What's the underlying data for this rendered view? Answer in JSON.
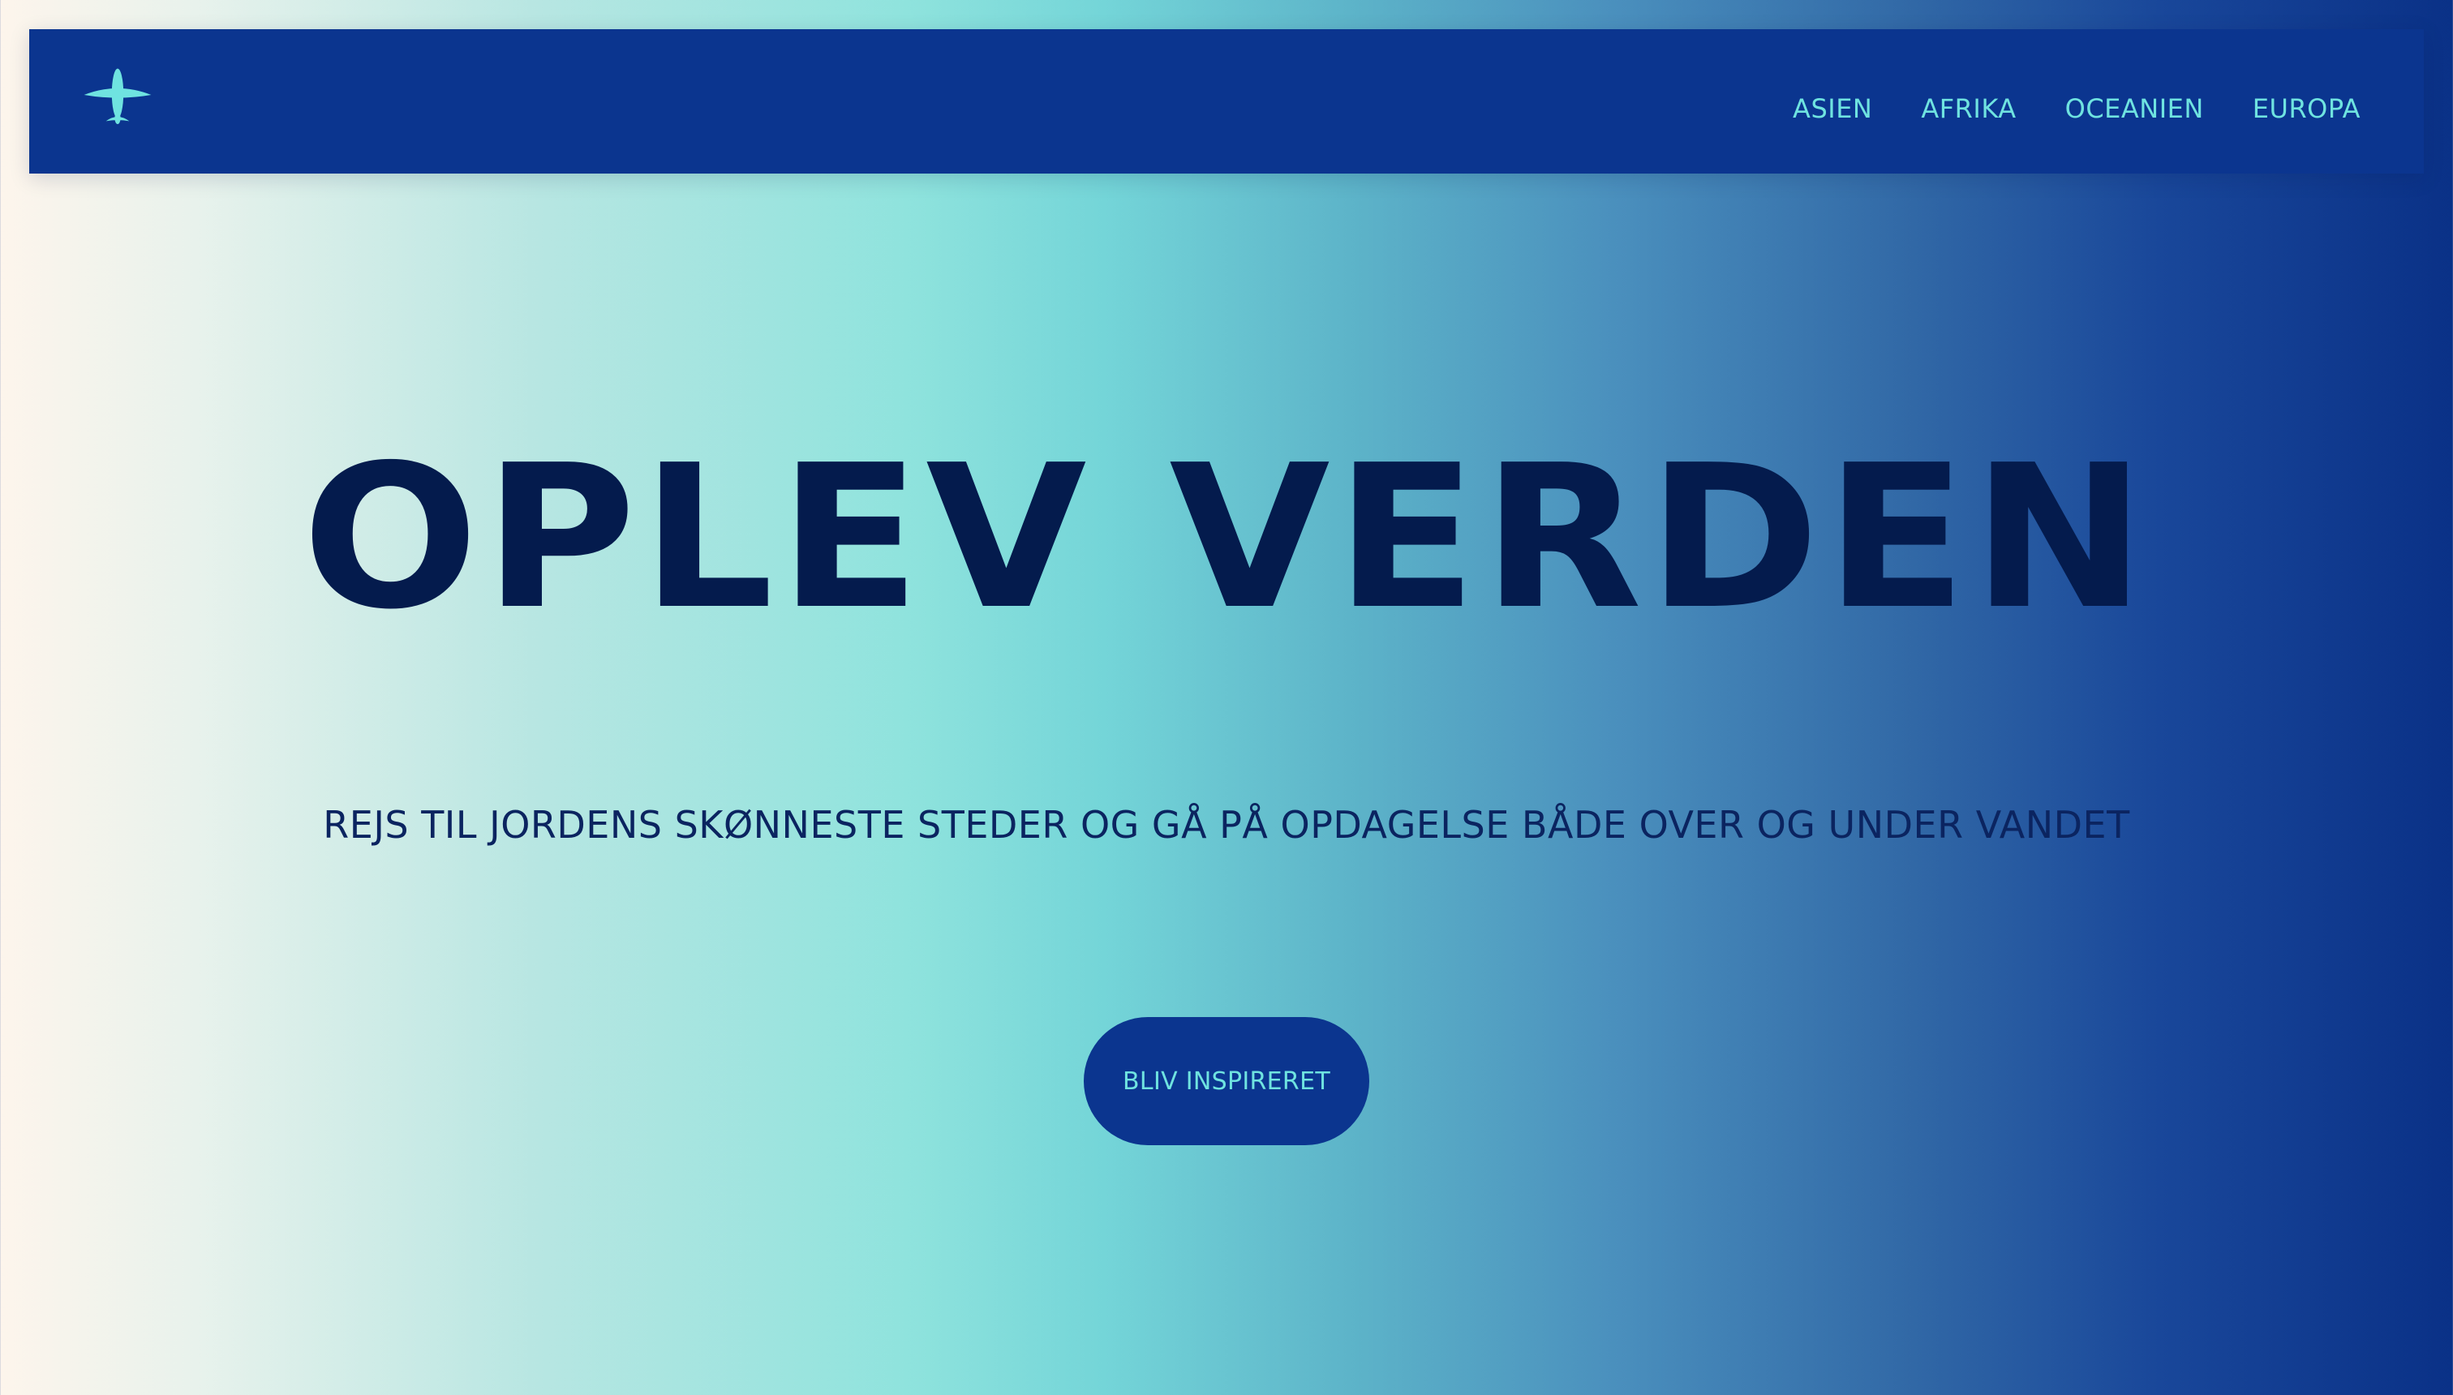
{
  "nav": {
    "logo_icon": "airplane-icon",
    "links": [
      "ASIEN",
      "AFRIKA",
      "OCEANIEN",
      "EUROPA"
    ]
  },
  "hero": {
    "title": "OPLEV VERDEN",
    "subtitle": "REJS TIL JORDENS SKØNNESTE STEDER OG GÅ PÅ OPDAGELSE BÅDE OVER OG UNDER VANDET",
    "button_label": "BLIV INSPIRERET"
  },
  "colors": {
    "navbar_bg": "#0b358f",
    "accent": "#6fe3e0",
    "title": "#041b4d",
    "gradient_start": "#fdf5ec",
    "gradient_mid": "#8fe3dd",
    "gradient_end": "#0a3187"
  }
}
